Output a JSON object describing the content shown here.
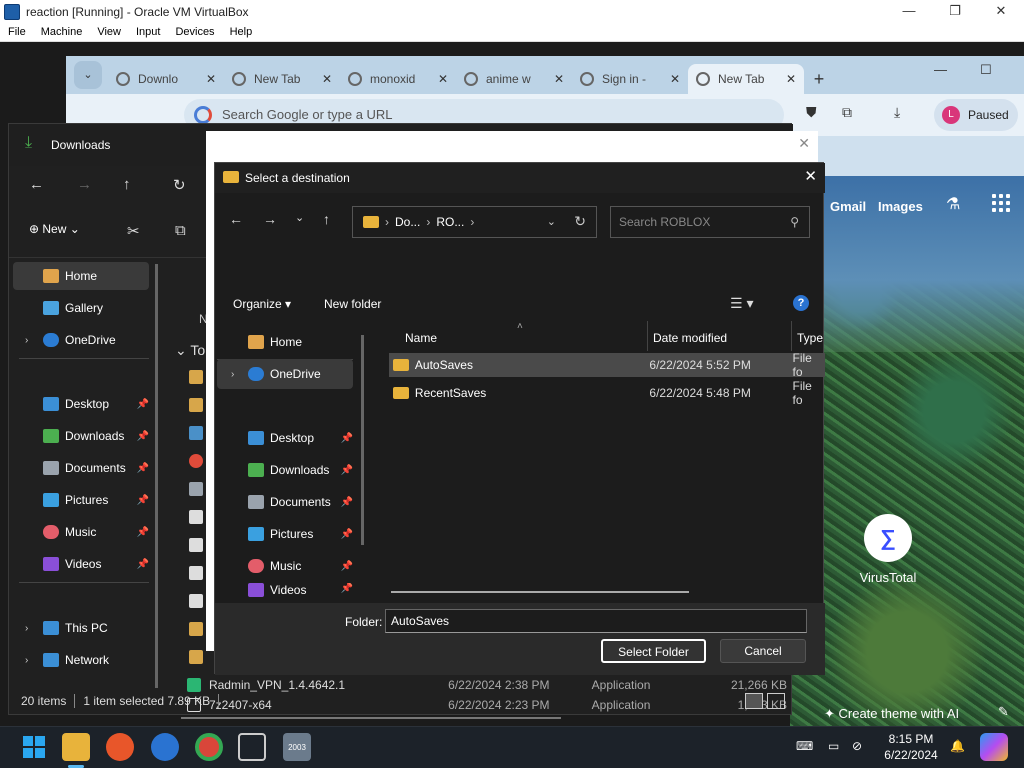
{
  "vbox": {
    "title": "reaction [Running] - Oracle VM VirtualBox",
    "menu": [
      "File",
      "Machine",
      "View",
      "Input",
      "Devices",
      "Help"
    ],
    "controls": [
      "—",
      "❐",
      "✕"
    ]
  },
  "chrome": {
    "tabs": [
      {
        "label": "Downlo"
      },
      {
        "label": "New Tab"
      },
      {
        "label": "monoxid"
      },
      {
        "label": "anime w"
      },
      {
        "label": "Sign in -"
      },
      {
        "label": "New Tab"
      }
    ],
    "omnibox_placeholder": "Search Google or type a URL",
    "profile_initial": "L",
    "profile_status": "Paused",
    "new_tab_symbol": "+",
    "min_symbol": "—",
    "max_symbol": "☐"
  },
  "newtab": {
    "gmail": "Gmail",
    "images": "Images",
    "shortcut_label": "VirusTotal",
    "create_theme": "✦ Create theme with AI"
  },
  "explorer": {
    "title": "Downloads",
    "new_label": "New",
    "nav_items": [
      {
        "label": "Home"
      },
      {
        "label": "Gallery"
      },
      {
        "label": "OneDrive"
      },
      {
        "label": "Desktop"
      },
      {
        "label": "Downloads"
      },
      {
        "label": "Documents"
      },
      {
        "label": "Pictures"
      },
      {
        "label": "Music"
      },
      {
        "label": "Videos"
      },
      {
        "label": "This PC"
      },
      {
        "label": "Network"
      }
    ],
    "partial_header": "N",
    "partial_group": "To",
    "files": [
      {
        "name": "Radmin_VPN_1.4.4642.1",
        "date": "6/22/2024 2:38 PM",
        "type": "Application",
        "size": "21,266 KB"
      },
      {
        "name": "7z2407-x64",
        "date": "6/22/2024 2:23 PM",
        "type": "Application",
        "size": "1,583 KB"
      }
    ],
    "status": {
      "count": "20 items",
      "selected": "1 item selected  7.89 KB"
    }
  },
  "dialog": {
    "title": "Select a destination",
    "breadcrumb": [
      "Do...",
      "RO..."
    ],
    "search_placeholder": "Search ROBLOX",
    "organize": "Organize",
    "new_folder": "New folder",
    "left_items": [
      {
        "label": "Home"
      },
      {
        "label": "OneDrive"
      },
      {
        "label": "Desktop"
      },
      {
        "label": "Downloads"
      },
      {
        "label": "Documents"
      },
      {
        "label": "Pictures"
      },
      {
        "label": "Music"
      },
      {
        "label": "Videos"
      }
    ],
    "columns": {
      "name": "Name",
      "date": "Date modified",
      "type": "Type"
    },
    "rows": [
      {
        "name": "AutoSaves",
        "date": "6/22/2024 5:52 PM",
        "type": "File fo"
      },
      {
        "name": "RecentSaves",
        "date": "6/22/2024 5:48 PM",
        "type": "File fo"
      }
    ],
    "folder_label": "Folder:",
    "folder_value": "AutoSaves",
    "select_button": "Select Folder",
    "cancel_button": "Cancel"
  },
  "taskbar": {
    "time": "8:15 PM",
    "date": "6/22/2024",
    "cpu_badge": "2003"
  },
  "colors": {
    "accent_blue": "#2a73d1",
    "folder_yellow": "#e8b33b",
    "download_green": "#4caf50"
  }
}
